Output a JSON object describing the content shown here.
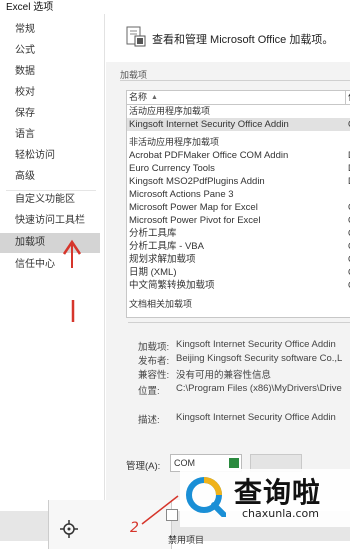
{
  "window": {
    "title": "Excel 选项"
  },
  "sidebar": {
    "items": [
      {
        "label": "常规"
      },
      {
        "label": "公式"
      },
      {
        "label": "数据"
      },
      {
        "label": "校对"
      },
      {
        "label": "保存"
      },
      {
        "label": "语言"
      },
      {
        "label": "轻松访问"
      },
      {
        "label": "高级"
      },
      {
        "label": "自定义功能区"
      },
      {
        "label": "快速访问工具栏"
      },
      {
        "label": "加载项",
        "active": true
      },
      {
        "label": "信任中心"
      }
    ]
  },
  "header": {
    "text": "查看和管理 Microsoft Office 加载项。"
  },
  "addins": {
    "section_title": "加载项",
    "col_name": "名称",
    "col_sort_icon": "sort-up-icon",
    "groups": [
      {
        "label": "活动应用程序加载项",
        "rows": [
          {
            "name": "Kingsoft Internet Security Office Addin",
            "right": "C",
            "selected": true
          }
        ]
      },
      {
        "label": "非活动应用程序加载项",
        "rows": [
          {
            "name": "Acrobat PDFMaker Office COM Addin",
            "right": "D"
          },
          {
            "name": "Euro Currency Tools",
            "right": "D"
          },
          {
            "name": "Kingsoft MSO2PdfPlugins Addin",
            "right": "D"
          },
          {
            "name": "Microsoft Actions Pane 3",
            "right": ""
          },
          {
            "name": "Microsoft Power Map for Excel",
            "right": "C"
          },
          {
            "name": "Microsoft Power Pivot for Excel",
            "right": "C"
          },
          {
            "name": "分析工具库",
            "right": "C"
          },
          {
            "name": "分析工具库 - VBA",
            "right": "C"
          },
          {
            "name": "规划求解加载项",
            "right": "C"
          },
          {
            "name": "日期 (XML)",
            "right": "C"
          },
          {
            "name": "中文简繁转换加载项",
            "right": "C"
          }
        ]
      }
    ],
    "doc_group_label": "文档相关加载项"
  },
  "details": {
    "addin_label": "加载项:",
    "addin_value": "Kingsoft Internet Security Office Addin",
    "publisher_label": "发布者:",
    "publisher_value": "Beijing Kingsoft Security software Co.,L",
    "compat_label": "兼容性:",
    "compat_value": "没有可用的兼容性信息",
    "location_label": "位置:",
    "location_value": "C:\\Program Files (x86)\\MyDrivers\\Drive",
    "desc_label": "描述:",
    "desc_value": "Kingsoft Internet Security Office Addin"
  },
  "manage": {
    "label": "管理(A):",
    "select_value": "COM"
  },
  "bottom": {
    "checkbox_label": "禁用项目"
  },
  "annotations": {
    "mark1": "1",
    "mark2": "2"
  },
  "watermark": {
    "brand": "查询啦",
    "domain": "chaxunla.com"
  },
  "colors": {
    "accent": "#2a8a3e",
    "annotation_red": "#d6352b",
    "selected_bg": "#d4d4d4"
  }
}
